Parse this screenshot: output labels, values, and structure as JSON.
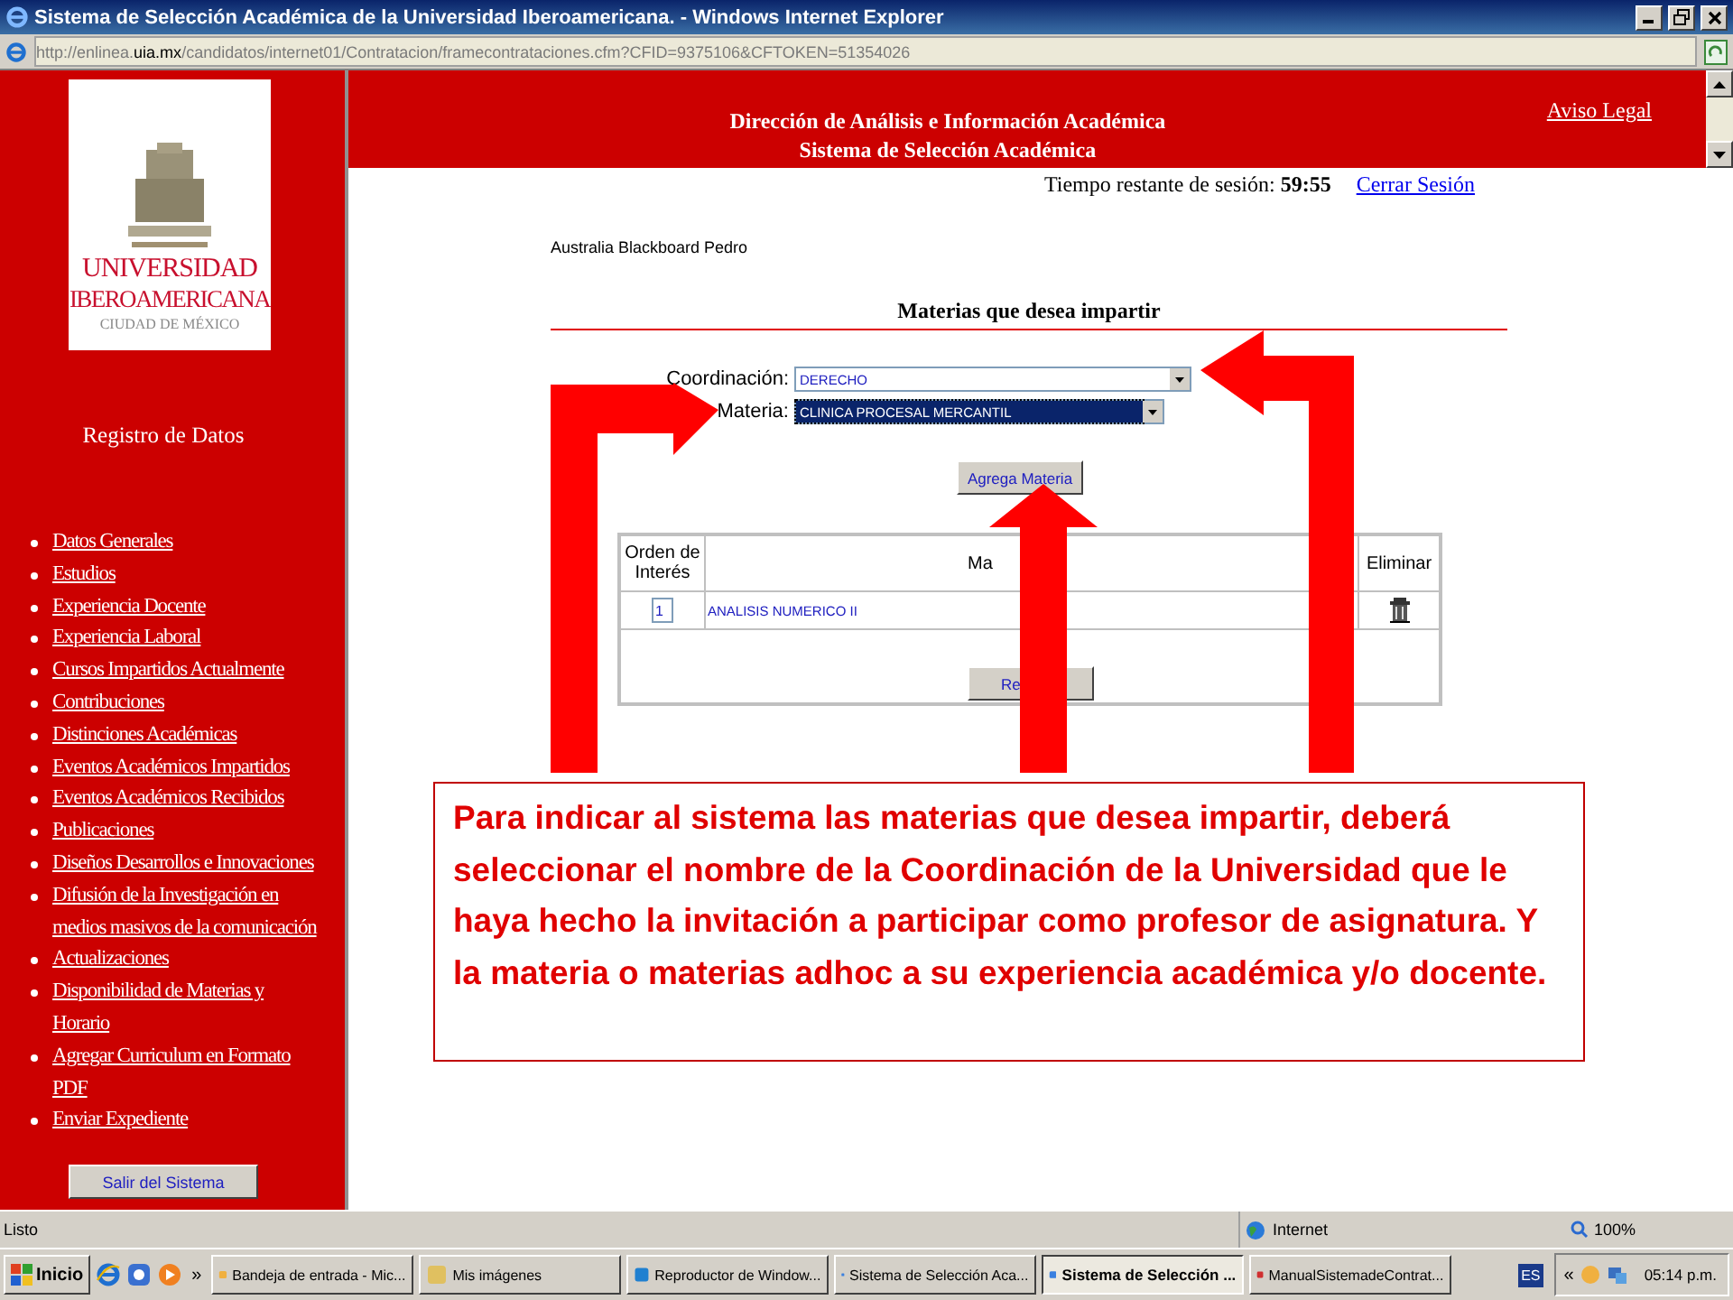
{
  "window": {
    "title": "Sistema de Selección Académica de la Universidad Iberoamericana. - Windows Internet Explorer"
  },
  "address_bar": {
    "url_prefix": "http://enlinea.",
    "url_domain": "uia.mx",
    "url_rest": "/candidatos/internet01/Contratacion/framecontrataciones.cfm?CFID=9375106&CFTOKEN=51354026"
  },
  "sidebar": {
    "logo": {
      "line_1": "UNIVERSIDAD",
      "line_2": "IBEROAMERICANA",
      "line_3": "CIUDAD DE MÉXICO"
    },
    "heading": "Registro de Datos",
    "items": [
      "Datos Generales",
      "Estudios",
      "Experiencia Docente",
      "Experiencia Laboral",
      "Cursos Impartidos Actualmente",
      "Contribuciones",
      "Distinciones Académicas",
      "Eventos Académicos Impartidos",
      "Eventos Académicos Recibidos",
      "Publicaciones",
      "Diseños Desarrollos e Innovaciones",
      "Difusión de la Investigación en medios masivos de la comunicación",
      "Actualizaciones",
      "Disponibilidad de Materias y Horario",
      "Agregar Curriculum en Formato PDF",
      "Enviar Expediente"
    ],
    "exit_button": "Salir del Sistema"
  },
  "header": {
    "line_1": "Dirección de Análisis e Información Académica",
    "line_2": "Sistema de Selección Académica",
    "legal_link": "Aviso Legal"
  },
  "session": {
    "label": "Tiempo restante de sesión:",
    "time": "59:55",
    "logout": "Cerrar Sesión"
  },
  "user_name": "Australia Blackboard Pedro",
  "form": {
    "title": "Materias que desea impartir",
    "fields": [
      {
        "label": "Coordinación:",
        "value": "DERECHO",
        "focused": false
      },
      {
        "label": "Materia:",
        "value": "CLINICA PROCESAL MERCANTIL",
        "focused": true
      }
    ],
    "add_button": "Agrega Materia"
  },
  "table": {
    "columns": [
      "Orden de Interés",
      "Ma",
      "Eliminar"
    ],
    "rows": [
      {
        "order": "1",
        "subject": "ANALISIS NUMERICO II"
      }
    ],
    "back_button": "Re"
  },
  "callout": {
    "text": "Para indicar al sistema las materias que desea impartir, deberá seleccionar el nombre de la Coordinación de la Universidad que le haya hecho la invitación a participar como profesor de asignatura. Y la materia o materias adhoc a su experiencia académica y/o docente."
  },
  "status_bar": {
    "text": "Listo",
    "zone": "Internet",
    "zoom": "100%"
  },
  "taskbar": {
    "start": "Inicio",
    "more": "»",
    "tasks": [
      {
        "label": "Bandeja de entrada - Mic...",
        "selected": false
      },
      {
        "label": "Mis imágenes",
        "selected": false
      },
      {
        "label": "Reproductor de Window...",
        "selected": false
      },
      {
        "label": "Sistema de Selección Aca...",
        "selected": false
      },
      {
        "label": "Sistema de Selección ...",
        "selected": true
      },
      {
        "label": "ManualSistemadeContrat...",
        "selected": false
      }
    ],
    "language": "ES",
    "tray_toggle": "«",
    "clock": "05:14 p.m."
  }
}
